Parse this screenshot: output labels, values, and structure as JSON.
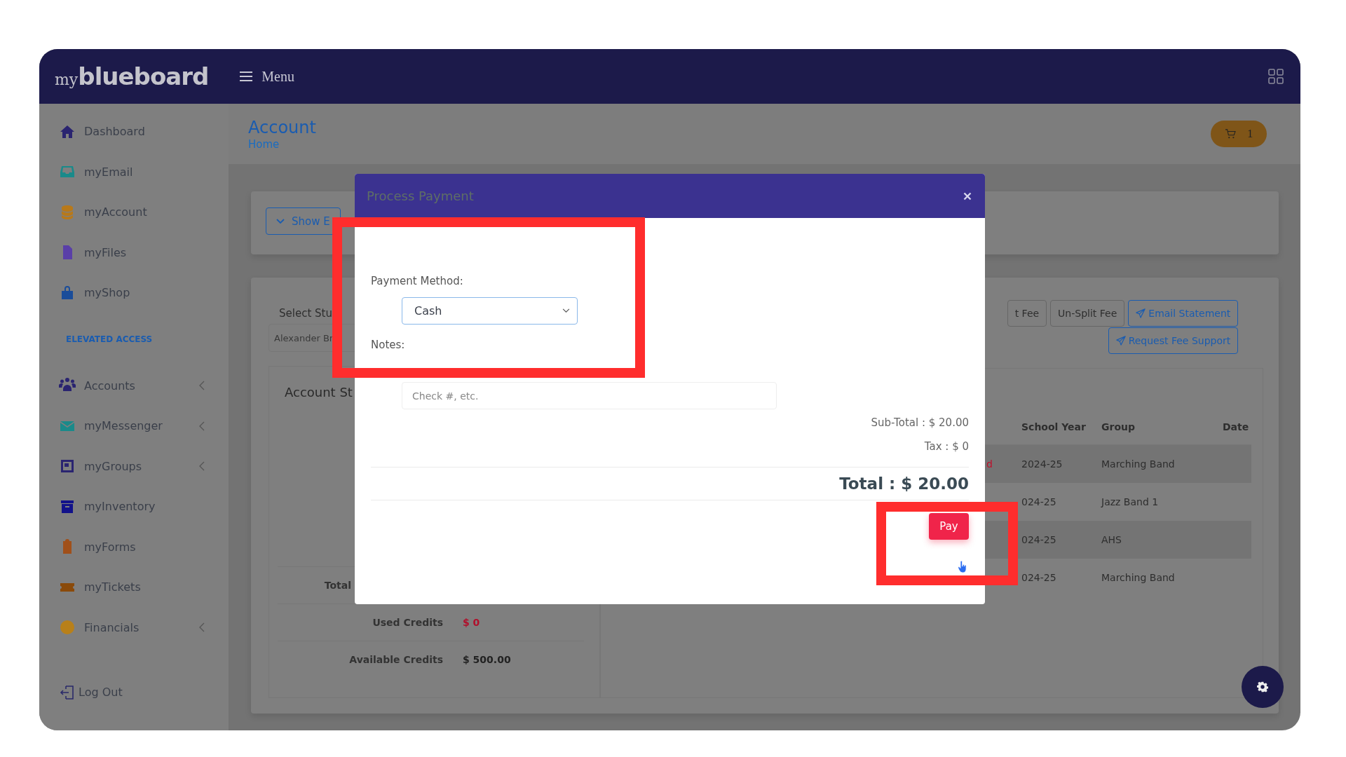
{
  "header": {
    "logo_script": "my",
    "logo_word": "blueboard",
    "menu_label": "Menu"
  },
  "sidebar": {
    "items": [
      {
        "kind": "link",
        "label": "Dashboard",
        "expandable": false
      },
      {
        "kind": "link",
        "label": "myEmail",
        "expandable": false
      },
      {
        "kind": "link",
        "label": "myAccount",
        "expandable": false
      },
      {
        "kind": "link",
        "label": "myFiles",
        "expandable": false
      },
      {
        "kind": "link",
        "label": "myShop",
        "expandable": false
      },
      {
        "kind": "heading",
        "label": "ELEVATED ACCESS",
        "expandable": false
      },
      {
        "kind": "link",
        "label": "Accounts",
        "expandable": true
      },
      {
        "kind": "link",
        "label": "myMessenger",
        "expandable": true
      },
      {
        "kind": "link",
        "label": "myGroups",
        "expandable": true
      },
      {
        "kind": "link",
        "label": "myInventory",
        "expandable": false
      },
      {
        "kind": "link",
        "label": "myForms",
        "expandable": false
      },
      {
        "kind": "link",
        "label": "myTickets",
        "expandable": false
      },
      {
        "kind": "link",
        "label": "Financials",
        "expandable": true
      },
      {
        "kind": "logout",
        "label": "Log Out",
        "expandable": false
      }
    ]
  },
  "page": {
    "title": "Account",
    "breadcrumb": "Home",
    "cart_count": "1"
  },
  "filters": {
    "toggle_label": "Show E"
  },
  "statement": {
    "student_label": "Select Stu",
    "student_value": "Alexander Br",
    "heading": "Account St",
    "rows": [
      {
        "label": "Total"
      },
      {
        "label": "Used Credits",
        "value": "$ 0",
        "negative": true
      },
      {
        "label": "Available Credits",
        "value": "$ 500.00",
        "negative": false
      }
    ]
  },
  "actions": [
    {
      "kind": "plain",
      "label": "t Fee"
    },
    {
      "kind": "plain",
      "label": "Un-Split Fee"
    },
    {
      "kind": "send",
      "label": "Email Statement"
    },
    {
      "kind": "send",
      "label": "Request Fee Support"
    }
  ],
  "table": {
    "columns": [
      "School Year",
      "Group",
      "Date"
    ],
    "rows": [
      {
        "status": "d",
        "school_year": "2024-25",
        "group": "Marching Band"
      },
      {
        "school_year": "024-25",
        "group": "Jazz Band 1"
      },
      {
        "school_year": "024-25",
        "group": "AHS"
      },
      {
        "school_year": "024-25",
        "group": "Marching Band"
      }
    ]
  },
  "modal": {
    "title": "Process Payment",
    "payment_method_label": "Payment Method:",
    "payment_method": "Cash",
    "notes_label": "Notes:",
    "notes_placeholder": "Check #, etc.",
    "subtotal": "Sub-Total : $ 20.00",
    "tax": "Tax : $ 0",
    "total": "Total : $ 20.00",
    "pay_label": "Pay"
  }
}
